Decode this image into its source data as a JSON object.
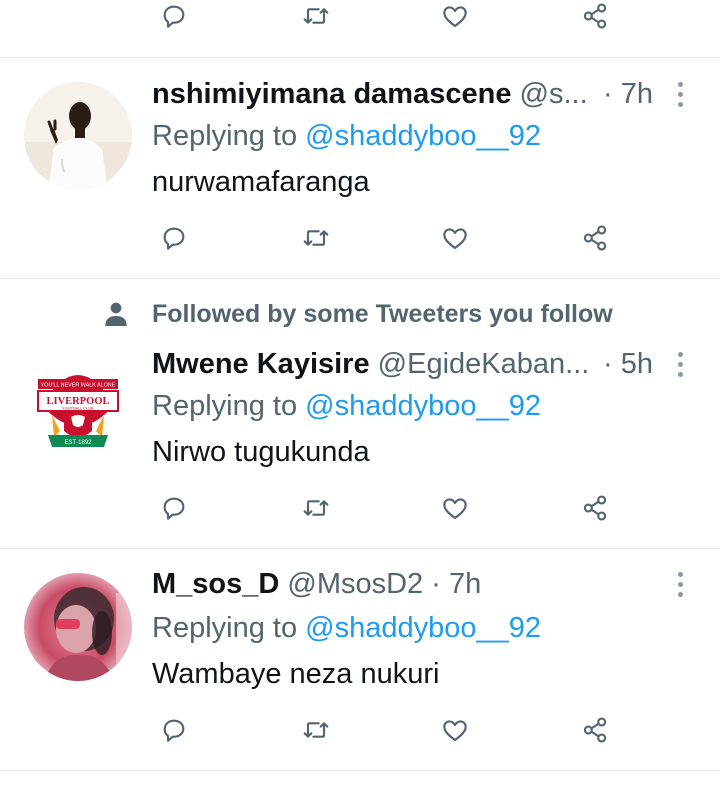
{
  "colors": {
    "accent": "#1d9bf0",
    "secondary_text": "#536471",
    "primary_text": "#0f1419",
    "divider": "#e6e6e6"
  },
  "actions": [
    "reply-icon",
    "retweet-icon",
    "like-icon",
    "share-icon"
  ],
  "social_context": {
    "icon": "person-icon",
    "text": "Followed by some Tweeters you follow"
  },
  "tweets": [
    {
      "name": "nshimiyimana damascene",
      "handle": "@s...",
      "separator": "·",
      "time": "7h",
      "replying_prefix": "Replying to",
      "replying_to": "@shaddyboo__92",
      "text": "nurwamafaranga"
    },
    {
      "name": "Mwene Kayisire",
      "handle": "@EgideKaban...",
      "separator": "·",
      "time": "5h",
      "replying_prefix": "Replying to",
      "replying_to": "@shaddyboo__92",
      "text": "Nirwo tugukunda",
      "avatar_text": {
        "top": "YOU'LL NEVER WALK ALONE",
        "main": "LIVERPOOL",
        "sub": "FOOTBALL CLUB",
        "est": "EST·1892"
      }
    },
    {
      "name": "M_sos_D",
      "handle": "@MsosD2",
      "separator": "·",
      "time": "7h",
      "replying_prefix": "Replying to",
      "replying_to": "@shaddyboo__92",
      "text": "Wambaye neza nukuri"
    }
  ]
}
